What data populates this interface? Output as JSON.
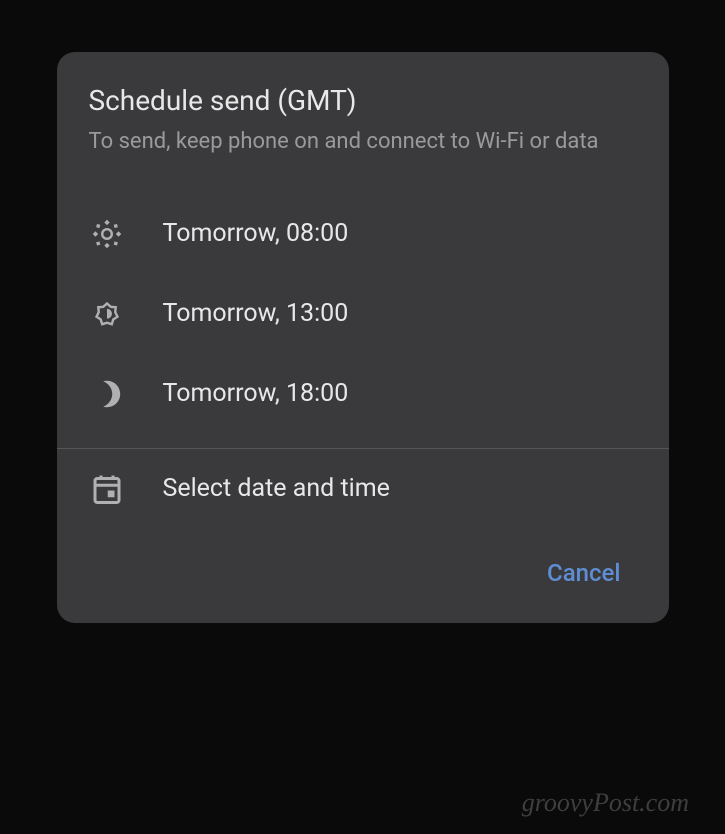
{
  "dialog": {
    "title": "Schedule send (GMT)",
    "subtitle": "To send, keep phone on and connect to Wi-Fi or data",
    "options": [
      {
        "icon": "sun-high",
        "label": "Tomorrow, 08:00"
      },
      {
        "icon": "sun-low",
        "label": "Tomorrow, 13:00"
      },
      {
        "icon": "moon",
        "label": "Tomorrow, 18:00"
      }
    ],
    "custom_option": {
      "icon": "calendar",
      "label": "Select date and time"
    },
    "cancel_label": "Cancel"
  },
  "watermark": "groovyPost.com"
}
